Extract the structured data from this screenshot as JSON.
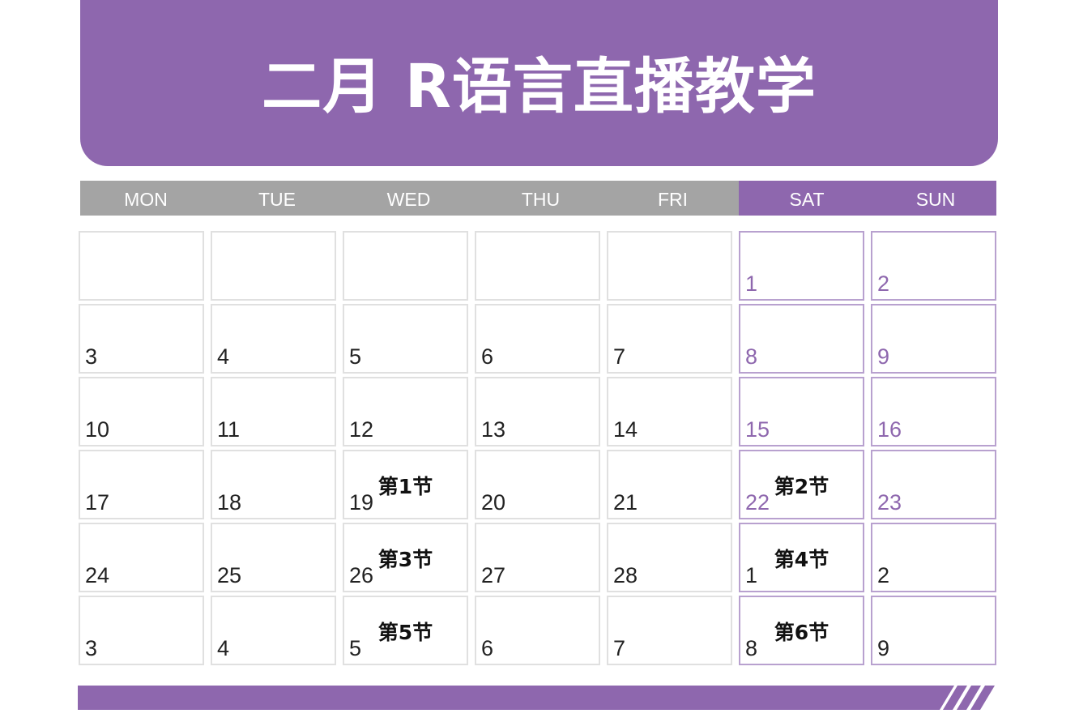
{
  "header": {
    "title": "二月 R语言直播教学"
  },
  "calendar": {
    "weekdays": [
      "MON",
      "TUE",
      "WED",
      "THU",
      "FRI",
      "SAT",
      "SUN"
    ],
    "weeks": [
      [
        {
          "day": ""
        },
        {
          "day": ""
        },
        {
          "day": ""
        },
        {
          "day": ""
        },
        {
          "day": ""
        },
        {
          "day": "1"
        },
        {
          "day": "2"
        }
      ],
      [
        {
          "day": "3"
        },
        {
          "day": "4"
        },
        {
          "day": "5"
        },
        {
          "day": "6"
        },
        {
          "day": "7"
        },
        {
          "day": "8"
        },
        {
          "day": "9"
        }
      ],
      [
        {
          "day": "10"
        },
        {
          "day": "11"
        },
        {
          "day": "12"
        },
        {
          "day": "13"
        },
        {
          "day": "14"
        },
        {
          "day": "15"
        },
        {
          "day": "16"
        }
      ],
      [
        {
          "day": "17"
        },
        {
          "day": "18"
        },
        {
          "day": "19",
          "session": "第1节"
        },
        {
          "day": "20"
        },
        {
          "day": "21"
        },
        {
          "day": "22",
          "session": "第2节"
        },
        {
          "day": "23"
        }
      ],
      [
        {
          "day": "24"
        },
        {
          "day": "25"
        },
        {
          "day": "26",
          "session": "第3节"
        },
        {
          "day": "27"
        },
        {
          "day": "28"
        },
        {
          "day": "1",
          "session": "第4节",
          "next_month": true
        },
        {
          "day": "2",
          "next_month": true
        }
      ],
      [
        {
          "day": "3",
          "next_month": true
        },
        {
          "day": "4",
          "next_month": true
        },
        {
          "day": "5",
          "session": "第5节",
          "next_month": true
        },
        {
          "day": "6",
          "next_month": true
        },
        {
          "day": "7",
          "next_month": true
        },
        {
          "day": "8",
          "session": "第6节",
          "next_month": true
        },
        {
          "day": "9",
          "next_month": true
        }
      ]
    ]
  },
  "colors": {
    "accent": "#8e67ae",
    "weekday_bar": "#a4a4a4",
    "cell_border": "#e0e0e0",
    "weekend_border": "#b8a1cf"
  }
}
